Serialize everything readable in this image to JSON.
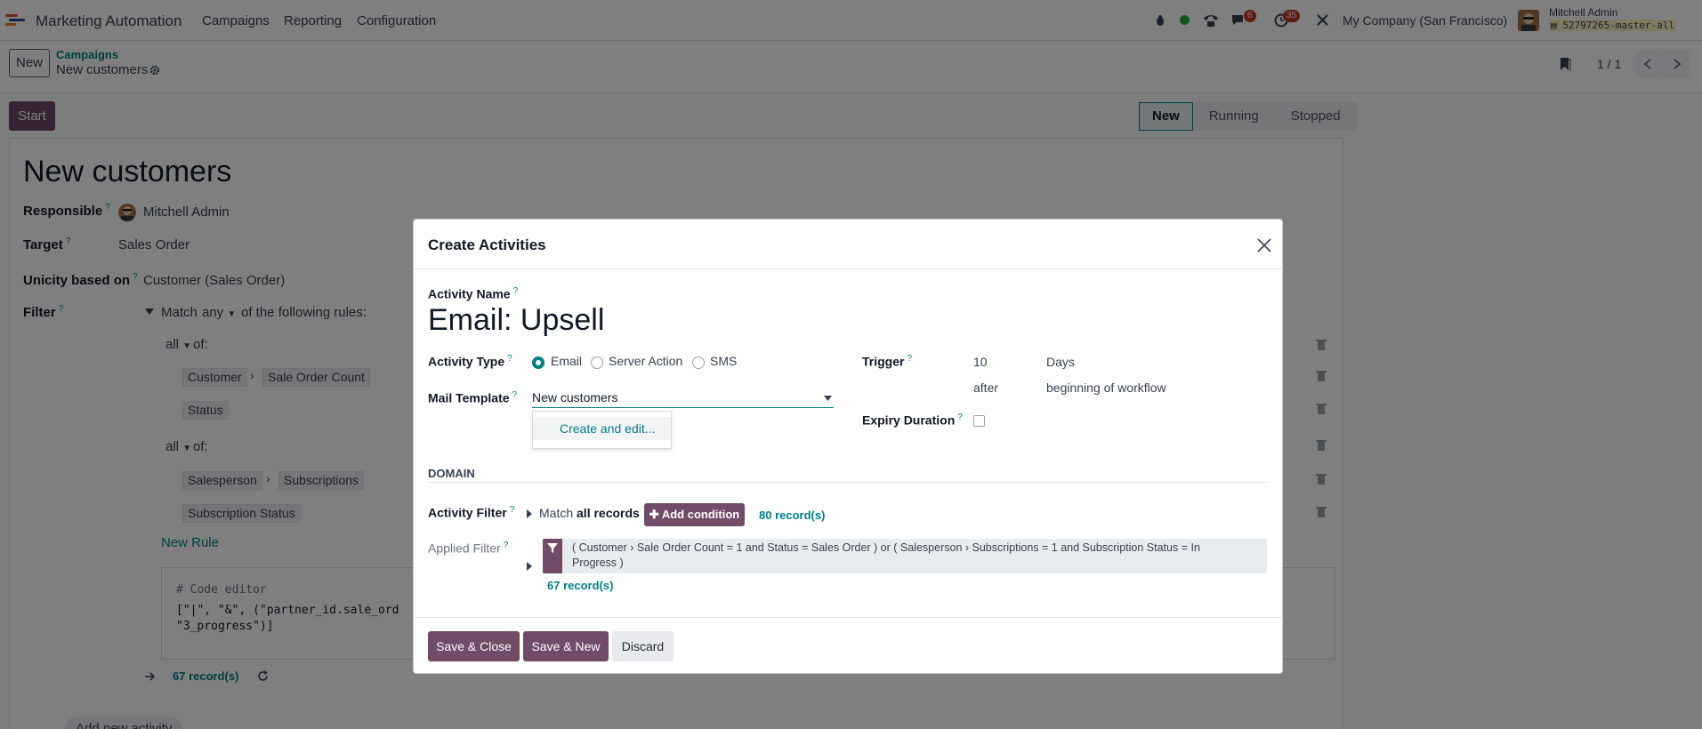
{
  "navbar": {
    "app_name": "Marketing Automation",
    "menu": [
      "Campaigns",
      "Reporting",
      "Configuration"
    ],
    "messages_badge": "6",
    "activities_badge": "35",
    "company": "My Company (San Francisco)",
    "user_name": "Mitchell Admin",
    "db_name": "52797265-master-all"
  },
  "control": {
    "new_label": "New",
    "breadcrumb_parent": "Campaigns",
    "breadcrumb_current": "New customers",
    "pager": "1 / 1"
  },
  "form": {
    "start_label": "Start",
    "status_steps": [
      "New",
      "Running",
      "Stopped"
    ],
    "title": "New customers",
    "responsible_label": "Responsible",
    "responsible_value": "Mitchell Admin",
    "target_label": "Target",
    "target_value": "Sales Order",
    "unicity_label": "Unicity based on",
    "unicity_value": "Customer (Sales Order)",
    "filter_label": "Filter",
    "match_prefix": "Match",
    "match_any": "any",
    "match_suffix": "of the following rules:",
    "group1_quant": "all",
    "group1_of": "of:",
    "group1_path_a": "Customer",
    "group1_path_b": "Sale Order Count",
    "group1_field2": "Status",
    "group2_quant": "all",
    "group2_of": "of:",
    "group2_path_a": "Salesperson",
    "group2_path_b": "Subscriptions",
    "group2_field2": "Subscription Status",
    "new_rule": "New Rule",
    "code_comment": "# Code editor",
    "code_line1": "[\"|\", \"&\", (\"partner_id.sale_ord",
    "code_line2": "\"3_progress\")]",
    "records_count": "67 record(s)",
    "add_activity": "Add new activity"
  },
  "modal": {
    "title": "Create Activities",
    "activity_name_label": "Activity Name",
    "activity_name_value": "Email: Upsell",
    "activity_type_label": "Activity Type",
    "activity_types": [
      "Email",
      "Server Action",
      "SMS"
    ],
    "selected_type": "Email",
    "mail_template_label": "Mail Template",
    "mail_template_value": "New customers",
    "dropdown_option": "Create and edit...",
    "trigger_label": "Trigger",
    "trigger_number": "10",
    "trigger_unit": "Days",
    "trigger_when": "after",
    "trigger_event": "beginning of workflow",
    "expiry_label": "Expiry Duration",
    "domain_header": "DOMAIN",
    "activity_filter_label": "Activity Filter",
    "match_text": "Match",
    "match_bold": "all records",
    "add_condition": "Add condition",
    "activity_filter_count": "80 record(s)",
    "applied_filter_label": "Applied Filter",
    "applied_filter_line1": "( Customer › Sale Order Count = 1 and Status = Sales Order ) or ( Salesperson › Subscriptions = 1 and Subscription Status = In",
    "applied_filter_line2": "Progress )",
    "applied_filter_count": "67 record(s)",
    "save_close": "Save & Close",
    "save_new": "Save & New",
    "discard": "Discard"
  },
  "colors": {
    "brand": "#714b67",
    "teal": "#017e84",
    "badge": "#c0392b"
  }
}
